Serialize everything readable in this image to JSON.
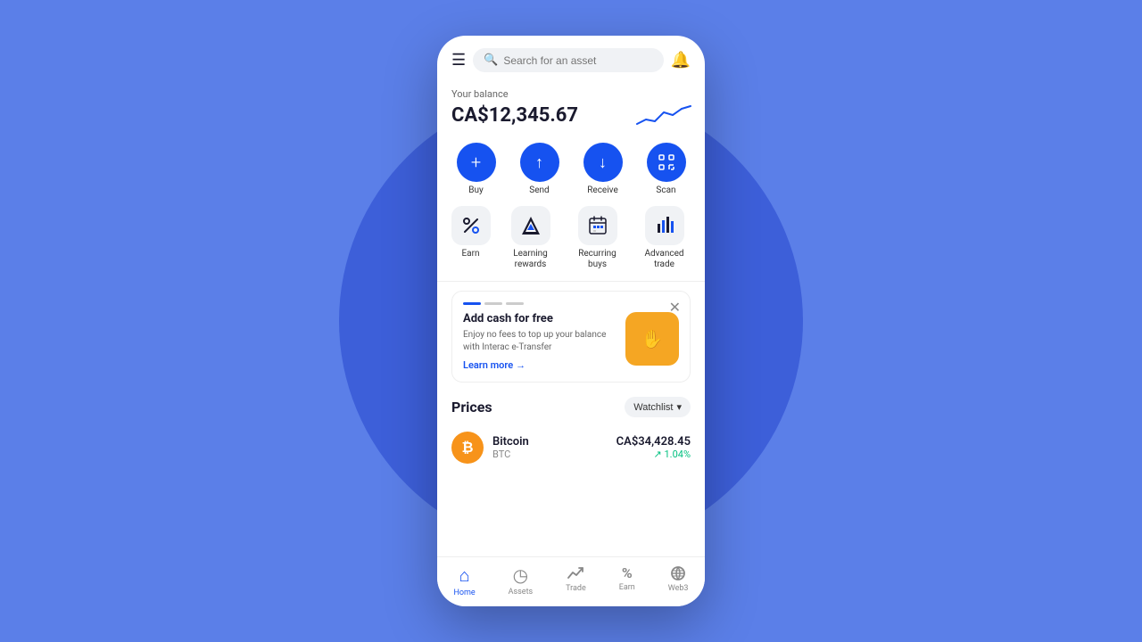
{
  "background": {
    "color": "#5b7fe8",
    "circle_color": "#3d5fd9"
  },
  "header": {
    "search_placeholder": "Search for an asset"
  },
  "balance": {
    "label": "Your balance",
    "amount": "CA$12,345.67"
  },
  "quick_actions": [
    {
      "id": "buy",
      "label": "Buy",
      "icon": "+"
    },
    {
      "id": "send",
      "label": "Send",
      "icon": "↑"
    },
    {
      "id": "receive",
      "label": "Receive",
      "icon": "↓"
    },
    {
      "id": "scan",
      "label": "Scan",
      "icon": "⊡"
    }
  ],
  "more_actions": [
    {
      "id": "earn",
      "label": "Earn",
      "icon": "%"
    },
    {
      "id": "learning-rewards",
      "label": "Learning rewards",
      "icon": "◆"
    },
    {
      "id": "recurring-buys",
      "label": "Recurring buys",
      "icon": "📅"
    },
    {
      "id": "advanced-trade",
      "label": "Advanced trade",
      "icon": "📊"
    }
  ],
  "promo": {
    "title": "Add cash for free",
    "description": "Enjoy no fees to top up your balance with Interac e-Transfer",
    "learn_more": "Learn more",
    "arrow": "→"
  },
  "prices": {
    "title": "Prices",
    "watchlist_label": "Watchlist",
    "assets": [
      {
        "name": "Bitcoin",
        "symbol": "BTC",
        "price": "CA$34,428.45",
        "change": "↗ 1.04%",
        "icon_color": "#f7931a",
        "icon_text": "₿"
      }
    ]
  },
  "bottom_nav": [
    {
      "id": "home",
      "label": "Home",
      "icon": "⌂",
      "active": true
    },
    {
      "id": "assets",
      "label": "Assets",
      "icon": "◷",
      "active": false
    },
    {
      "id": "trade",
      "label": "Trade",
      "icon": "↗",
      "active": false
    },
    {
      "id": "earn",
      "label": "Earn",
      "icon": "%",
      "active": false
    },
    {
      "id": "web3",
      "label": "Web3",
      "icon": "⊘",
      "active": false
    }
  ]
}
